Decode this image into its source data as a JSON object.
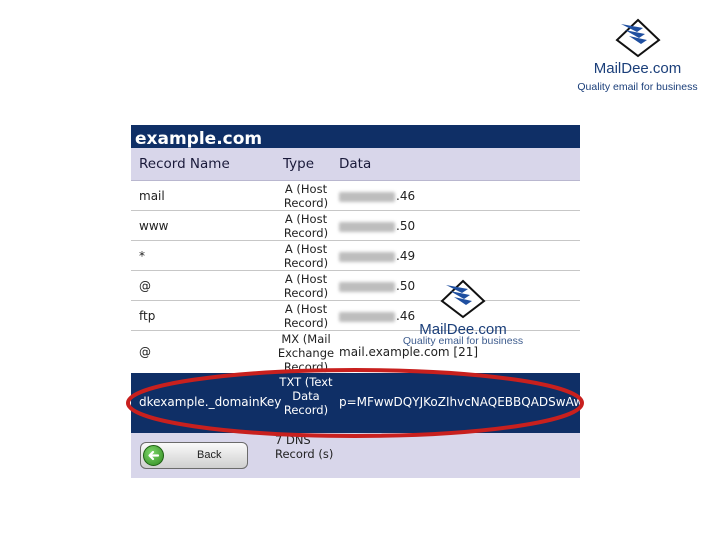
{
  "logo": {
    "brand": "MailDee.com",
    "tagline": "Quality email for business"
  },
  "panel": {
    "title": "example.com",
    "columns": {
      "name": "Record Name",
      "type": "Type",
      "data": "Data"
    },
    "rows": [
      {
        "name": "mail",
        "type": "A (Host Record)",
        "data_suffix": ".46"
      },
      {
        "name": "www",
        "type": "A (Host Record)",
        "data_suffix": ".50"
      },
      {
        "name": "*",
        "type": "A (Host Record)",
        "data_suffix": ".49"
      },
      {
        "name": "@",
        "type": "A (Host Record)",
        "data_suffix": ".50"
      },
      {
        "name": "ftp",
        "type": "A (Host Record)",
        "data_suffix": ".46"
      },
      {
        "name": "@",
        "type": "MX (Mail Exchange Record)",
        "data": "mail.example.com [21]"
      }
    ],
    "highlighted_row": {
      "name": "dkexample._domainKey",
      "type": "TXT (Text Data Record)",
      "data": "p=MFwwDQYJKoZIhvcNAQEBBQADSwAw"
    },
    "footer": {
      "back_label": "Back",
      "count_text": "7 DNS Record (s)"
    }
  },
  "watermark": {
    "brand": "MailDee.com",
    "tagline": "Quality email for business"
  },
  "colors": {
    "panel_bg": "#0f2f66",
    "header_bg": "#d8d6ea",
    "highlight": "#c8201e",
    "brand": "#1b3f7a"
  }
}
